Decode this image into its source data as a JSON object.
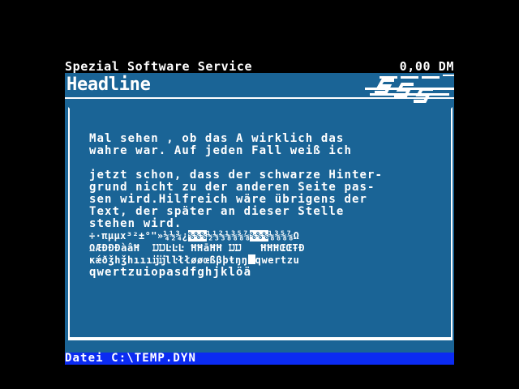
{
  "header": {
    "title": "Spezial Software Service",
    "amount": "0,00 DM"
  },
  "panel": {
    "headline": "Headline",
    "logo_text": "SSS",
    "body_lines": [
      "Mal sehen , ob das A wirklich das",
      "wahre war. Auf jeden Fall weiß ich",
      "",
      "jetzt schon, dass der schwarze Hinter-",
      "grund nicht zu der anderen Seite pas-",
      "sen wird.Hilfreich wäre übrigens der",
      "Text, der später an dieser Stelle",
      "stehen wird."
    ],
    "charset_lines": [
      "÷·πμμx³²±°\"»¼½¾¿",
      "ΩÆÐÐÐàâĦ  ĲĲĿĿĿ ĦĦāĦĦ ĲĲ   ĦĦĦŒŒŦÐ",
      "κǽðǯhǯhıııĳĳlŀłłøøœßβþŧŋŋ",
      "qwertzuiopasdfghjklöä"
    ],
    "charset_inverted": [
      "%%%",
      "%%%"
    ],
    "charset_tail": [
      "½⅓⅔⅛⅜⅝⅞",
      "⅛⅜⅝⅞Ω",
      "qwertzu"
    ]
  },
  "status": {
    "text": "Datei C:\\TEMP.DYN"
  },
  "colors": {
    "background": "#000000",
    "panel": "#1a6496",
    "status_bar": "#0b2bf2",
    "text": "#ffffff"
  }
}
